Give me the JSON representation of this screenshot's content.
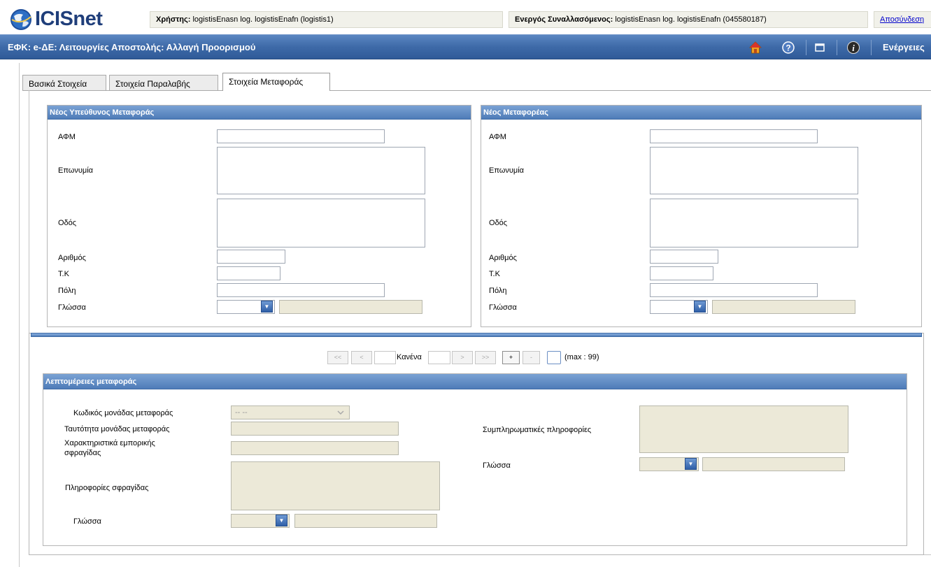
{
  "header": {
    "brand": "ICISnet",
    "user_label": "Χρήστης:",
    "user_value": "logistisEnasn log. logistisEnafn (logistis1)",
    "trader_label": "Ενεργός Συναλλασόμενος:",
    "trader_value": "logistisEnasn log. logistisEnafn (045580187)",
    "logout": "Αποσύνδεση"
  },
  "titlebar": {
    "title": "ΕΦΚ: e-ΔΕ: Λειτουργίες Αποστολής: Αλλαγή Προορισμού",
    "actions": "Ενέργειες",
    "icons": [
      "home-icon",
      "help-icon",
      "window-icon",
      "info-icon"
    ]
  },
  "tabs": [
    {
      "label": "Βασικά Στοιχεία",
      "active": false
    },
    {
      "label": "Στοιχεία Παραλαβής",
      "active": false
    },
    {
      "label": "Στοιχεία Μεταφοράς",
      "active": true
    }
  ],
  "panel_left": {
    "title": "Νέος Υπεύθυνος Μεταφοράς",
    "afm": "ΑΦΜ",
    "name": "Επωνυμία",
    "street": "Οδός",
    "number": "Αριθμός",
    "zip": "Τ.Κ",
    "city": "Πόλη",
    "language": "Γλώσσα"
  },
  "panel_right": {
    "title": "Νέος Μεταφορέας",
    "afm": "ΑΦΜ",
    "name": "Επωνυμία",
    "street": "Οδός",
    "number": "Αριθμός",
    "zip": "Τ.Κ",
    "city": "Πόλη",
    "language": "Γλώσσα"
  },
  "pager": {
    "first": "<<",
    "prev": "<",
    "current": "Κανένα",
    "next": ">",
    "last": ">>",
    "add": "+",
    "remove": "-",
    "max": "(max : 99)"
  },
  "transport": {
    "title": "Λεπτομέρειες μεταφοράς",
    "unit_code": "Κωδικός μονάδας μεταφοράς",
    "unit_code_value": "-- --",
    "unit_id": "Ταυτότητα μονάδας μεταφοράς",
    "seal_features_1": "Χαρακτηριστικά εμπορικής",
    "seal_features_2": "σφραγίδας",
    "seal_info": "Πληροφορίες σφραγίδας",
    "language": "Γλώσσα",
    "complementary": "Συμπληρωματικές πληροφορίες",
    "language_right": "Γλώσσα"
  },
  "colors": {
    "titlebar": "#3e6aa8",
    "panel_header": "#4f7cb8",
    "readonly_bg": "#ece9d8"
  }
}
